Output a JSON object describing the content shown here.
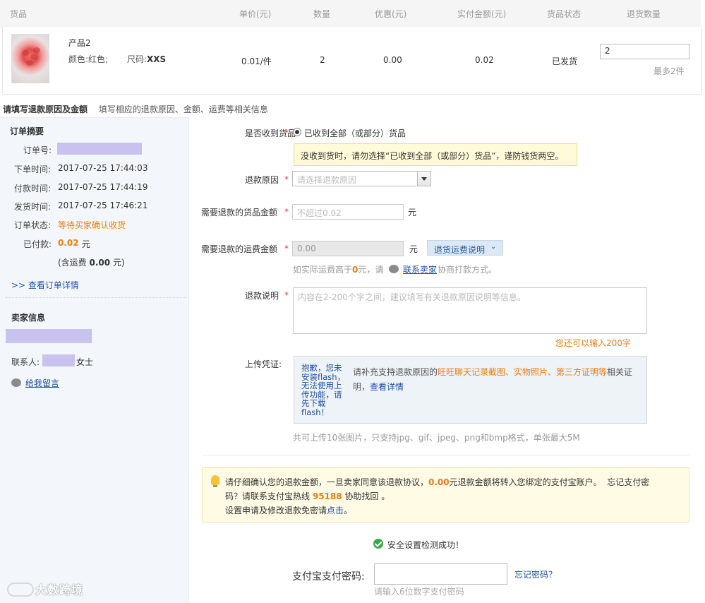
{
  "table": {
    "headers": [
      "货品",
      "单价(元)",
      "数量",
      "优惠(元)",
      "实付金额(元)",
      "货品状态",
      "退货数量"
    ],
    "row": {
      "product_name": "产品2",
      "color": "颜色:红色;",
      "size_label": "尺码:",
      "size_value": "XXS",
      "unit_price": "0.01/件",
      "quantity": "2",
      "discount": "0.00",
      "paid": "0.02",
      "status": "已发货",
      "return_qty": "2",
      "return_max": "最多2件"
    }
  },
  "section": {
    "title": "请填写退款原因及金额",
    "subtitle": "填写相应的退款原因、金额、运费等相关信息"
  },
  "order_summary": {
    "title": "订单摘要",
    "order_no_label": "订单号:",
    "order_time_label": "下单时间:",
    "order_time": "2017-07-25 17:44:03",
    "pay_time_label": "付款时间:",
    "pay_time": "2017-07-25 17:44:19",
    "ship_time_label": "发货时间:",
    "ship_time": "2017-07-25 17:46:21",
    "status_label": "订单状态:",
    "status": "等待买家确认收货",
    "paid_label": "已付款:",
    "paid_amount": "0.02",
    "paid_unit": "元",
    "shipping_prefix": "(含运费",
    "shipping_amount": "0.00",
    "shipping_suffix": "元)",
    "details_link": ">> 查看订单详情"
  },
  "seller": {
    "title": "卖家信息",
    "contact_label": "联系人:",
    "contact_suffix": "女士",
    "message_link": "给我留言"
  },
  "form": {
    "received_label": "是否收到货品",
    "received_option": "已收到全部（或部分）货品",
    "received_notice": "没收到货时，请勿选择“已收到全部（或部分）货品”，谨防钱货两空。",
    "reason_label": "退款原因",
    "reason_placeholder": "请选择退款原因",
    "goods_amount_label": "需要退款的货品金额",
    "goods_amount_placeholder": "不超过0.02",
    "goods_amount_unit": "元",
    "shipping_amount_label": "需要退款的运费金额",
    "shipping_amount_value": "0.00",
    "shipping_amount_unit": "元",
    "shipping_explain_button": "退货运费说明",
    "shipping_hint_prefix": "如实际运费高于",
    "shipping_hint_amount": "0",
    "shipping_hint_mid": "元，请",
    "shipping_hint_link": "联系卖家",
    "shipping_hint_suffix": "协商打款方式。",
    "desc_label": "退款说明",
    "desc_placeholder": "内容在2-200个字之间，建议填写有关退款原因说明等信息。",
    "desc_counter": "您还可以输入200字",
    "upload_label": "上传凭证:",
    "flash_message": "抱歉，您未安装flash，无法使用上传功能，请先下载flash！",
    "upload_hint_prefix": "请补充支持退款原因的",
    "upload_hint_highlight": "旺旺聊天记录截图、实物照片、第三方证明等",
    "upload_hint_suffix": "相关证明，",
    "upload_hint_link": "查看详情",
    "upload_limit": "共可上传10张图片，只支持jpg、gif、jpeg、png和bmp格式，单张最大5M"
  },
  "alert": {
    "line1_prefix": "请仔细确认您的退款金额，一旦卖家同意该退款协议，",
    "line1_amount": "0.00",
    "line1_mid": "元退款金额将转入您绑定的支付宝账户。",
    "line1_suffix": "忘记支付密",
    "line2_prefix": "码？请联系支付宝热线",
    "line2_phone": "95188",
    "line2_suffix": "协助找回 。",
    "line3_prefix": "设置申请及修改退款免密请",
    "line3_link": "点击",
    "line3_suffix": "。"
  },
  "security": {
    "check_text": "安全设置检测成功！",
    "pwd_label": "支付宝支付密码:",
    "pwd_hint": "请输入6位数字支付密码",
    "forgot": "忘记密码？"
  },
  "watermark": "大数跨境"
}
